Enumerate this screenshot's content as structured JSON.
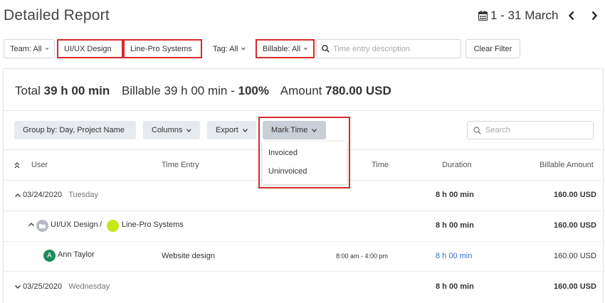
{
  "page": {
    "title": "Detailed Report"
  },
  "date_nav": {
    "range": "1 - 31 March",
    "prev_icon": "chevron-left-icon",
    "next_icon": "chevron-right-icon"
  },
  "filters": {
    "team": "Team: All",
    "project": "UI/UX Design",
    "client": "Line-Pro Systems",
    "tag": "Tag: All",
    "billable": "Billable: All",
    "search_placeholder": "Time entry description",
    "clear_label": "Clear Filter"
  },
  "summary": {
    "total_label": "Total",
    "total_value": "39 h 00 min",
    "billable_label": "Billable 39 h 00 min -",
    "billable_pct": "100%",
    "amount_label": "Amount",
    "amount_value": "780.00 USD"
  },
  "toolbar": {
    "group_by": "Group by: Day, Project Name",
    "columns": "Columns",
    "export": "Export",
    "mark_time": "Mark Time",
    "search_placeholder": "Search"
  },
  "mark_time_menu": {
    "options": [
      "Invoiced",
      "Uninvoiced"
    ]
  },
  "table": {
    "headers": {
      "user": "User",
      "time_entry": "Time Entry",
      "time": "Time",
      "duration": "Duration",
      "billable_amount": "Billable Amount"
    },
    "day1": {
      "date": "03/24/2020",
      "weekday": "Tuesday",
      "duration": "8 h 00 min",
      "amount": "160.00 USD"
    },
    "project_row": {
      "project": "UI/UX Design",
      "separator": "/",
      "client": "Line-Pro Systems",
      "duration": "8 h 00 min",
      "amount": "160.00 USD"
    },
    "entry_row": {
      "avatar_letter": "A",
      "user": "Ann Taylor",
      "description": "Website design",
      "time": "8:00 am - 4:00 pm",
      "duration": "8 h 00 min",
      "amount": "160.00 USD"
    },
    "day2": {
      "date": "03/25/2020",
      "weekday": "Wednesday",
      "duration": "8 h 00 min",
      "amount": "160.00 USD"
    }
  },
  "colors": {
    "highlight": "#d62b2b",
    "link": "#2f6fd1",
    "avatar": "#1e8a5a",
    "client_dot": "#c5e81a"
  }
}
